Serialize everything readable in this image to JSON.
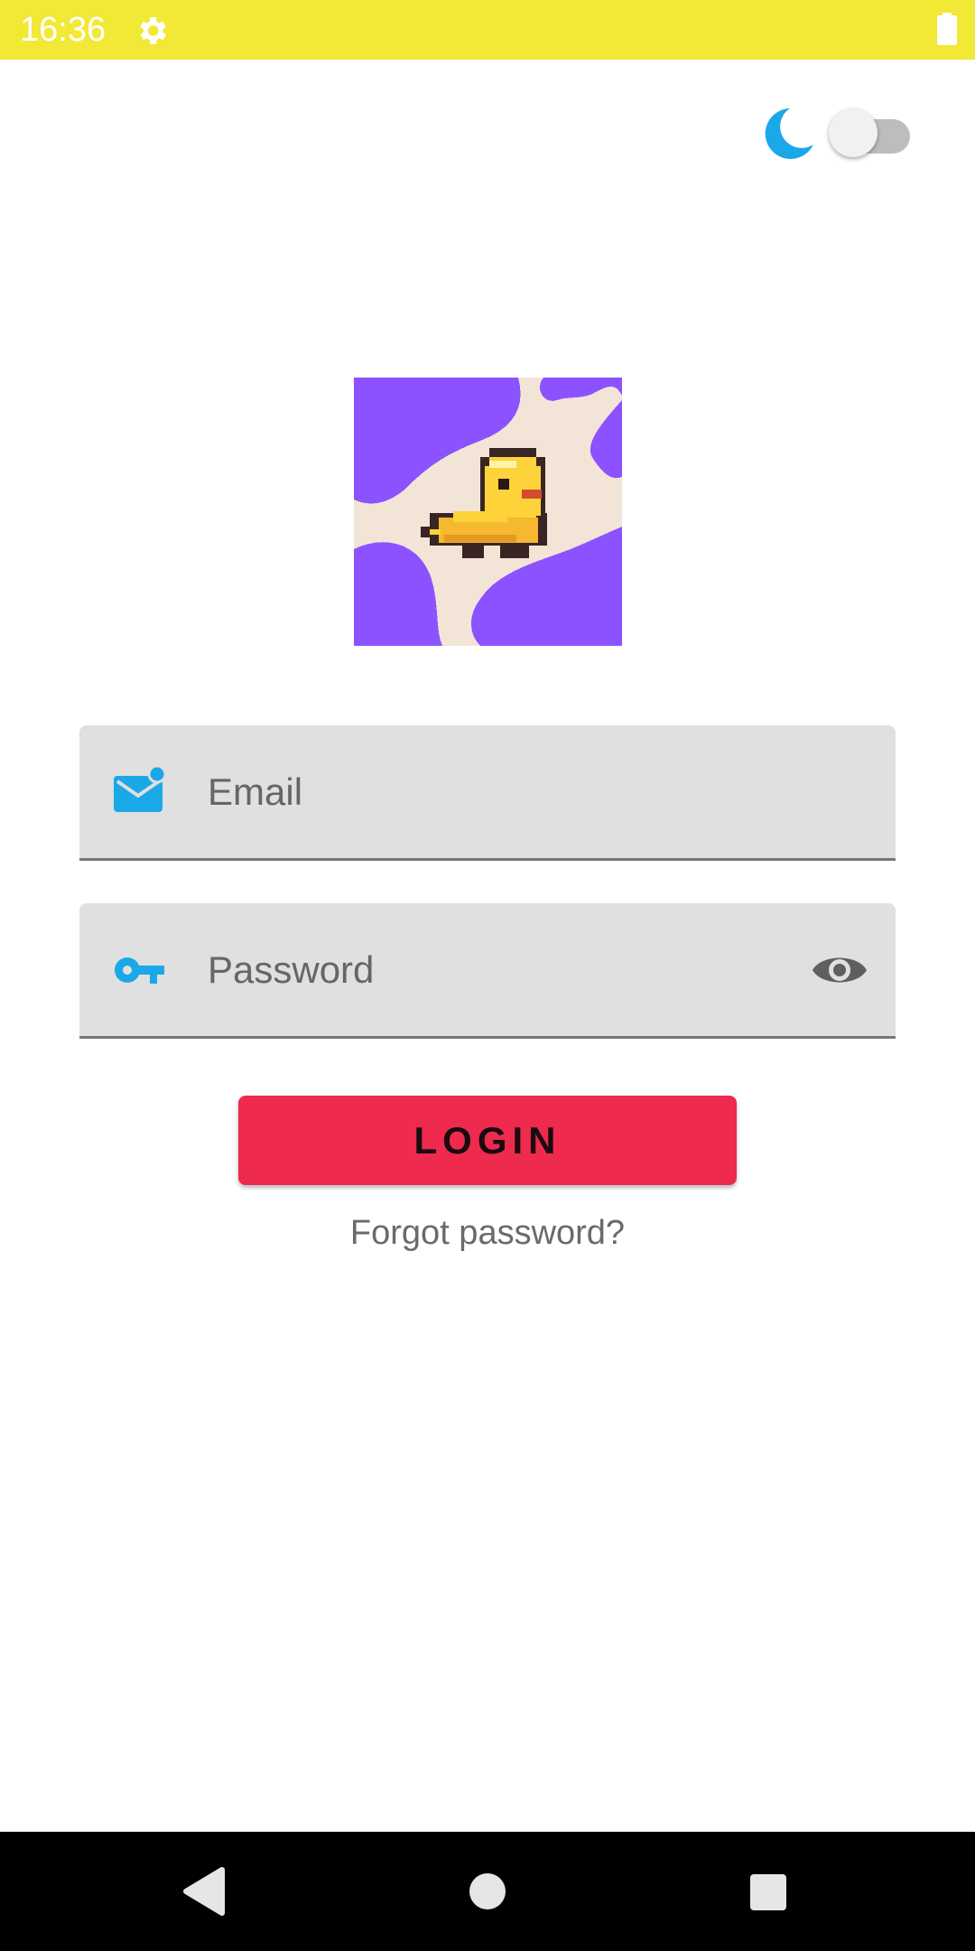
{
  "status_bar": {
    "time": "16:36",
    "background_color": "#f2e836",
    "icons": [
      "gear-icon",
      "battery-icon"
    ]
  },
  "theme_toggle": {
    "icon": "moon-icon",
    "icon_color": "#1aa8e8",
    "dark_mode_enabled": false
  },
  "logo": {
    "description_icon": "pixel-duck-logo",
    "colors": {
      "purple": "#8c52ff",
      "cream": "#f3e4d8",
      "duck_yellow": "#fed33a"
    }
  },
  "form": {
    "email": {
      "placeholder": "Email",
      "value": "",
      "icon": "email-icon"
    },
    "password": {
      "placeholder": "Password",
      "value": "",
      "icon": "key-icon",
      "toggle_icon": "eye-icon"
    },
    "field_background": "#e0e0e0",
    "icon_color": "#1aa8e8"
  },
  "login_button": {
    "label": "LOGIN",
    "color": "#ee2a4f"
  },
  "forgot_password": {
    "label": "Forgot password?"
  },
  "nav_bar": {
    "icons": [
      "back-icon",
      "home-icon",
      "recents-icon"
    ]
  }
}
